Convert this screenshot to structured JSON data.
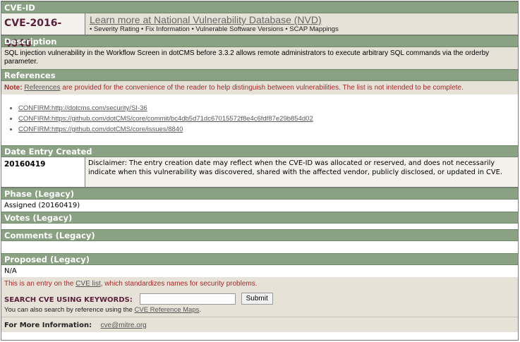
{
  "sections": {
    "cve_id": "CVE-ID",
    "description": "Description",
    "references": "References",
    "date_entry_created": "Date Entry Created",
    "phase": "Phase (Legacy)",
    "votes": "Votes (Legacy)",
    "comments": "Comments (Legacy)",
    "proposed": "Proposed (Legacy)"
  },
  "cve": {
    "id": "CVE-2016-4040",
    "nvd_link": "Learn more at National Vulnerability Database (NVD)",
    "nvd_features": "• Severity Rating • Fix Information • Vulnerable Software Versions • SCAP Mappings"
  },
  "description": "SQL injection vulnerability in the Workflow Screen in dotCMS before 3.3.2 allows remote administrators to execute arbitrary SQL commands via the orderby parameter.",
  "references_note": {
    "label": "Note:",
    "link": "References",
    "text": " are provided for the convenience of the reader to help distinguish between vulnerabilities. The list is not intended to be complete."
  },
  "references": [
    "CONFIRM:http://dotcms.com/security/SI-36",
    "CONFIRM:https://github.com/dotCMS/core/commit/bc4db5d71dc67015572f8e4c6fdf87e29b854d02",
    "CONFIRM:https://github.com/dotCMS/core/issues/8840"
  ],
  "date_entry": {
    "value": "20160419",
    "disclaimer": "Disclaimer: The entry creation date may reflect when the CVE-ID was allocated or reserved, and does not necessarily indicate when this vulnerability was discovered, shared with the affected vendor, publicly disclosed, or updated in CVE."
  },
  "phase": "Assigned (20160419)",
  "proposed": "N/A",
  "entry_note": {
    "prefix": "This is an entry on the ",
    "link": "CVE list",
    "suffix": ", which standardizes names for security problems."
  },
  "search": {
    "label": "SEARCH CVE USING KEYWORDS:",
    "button": "Submit",
    "sub_prefix": "You can also search by reference using the ",
    "sub_link": "CVE Reference Maps",
    "sub_suffix": "."
  },
  "more_info": {
    "label": "For More Information:",
    "email": "cve@mitre.org"
  }
}
